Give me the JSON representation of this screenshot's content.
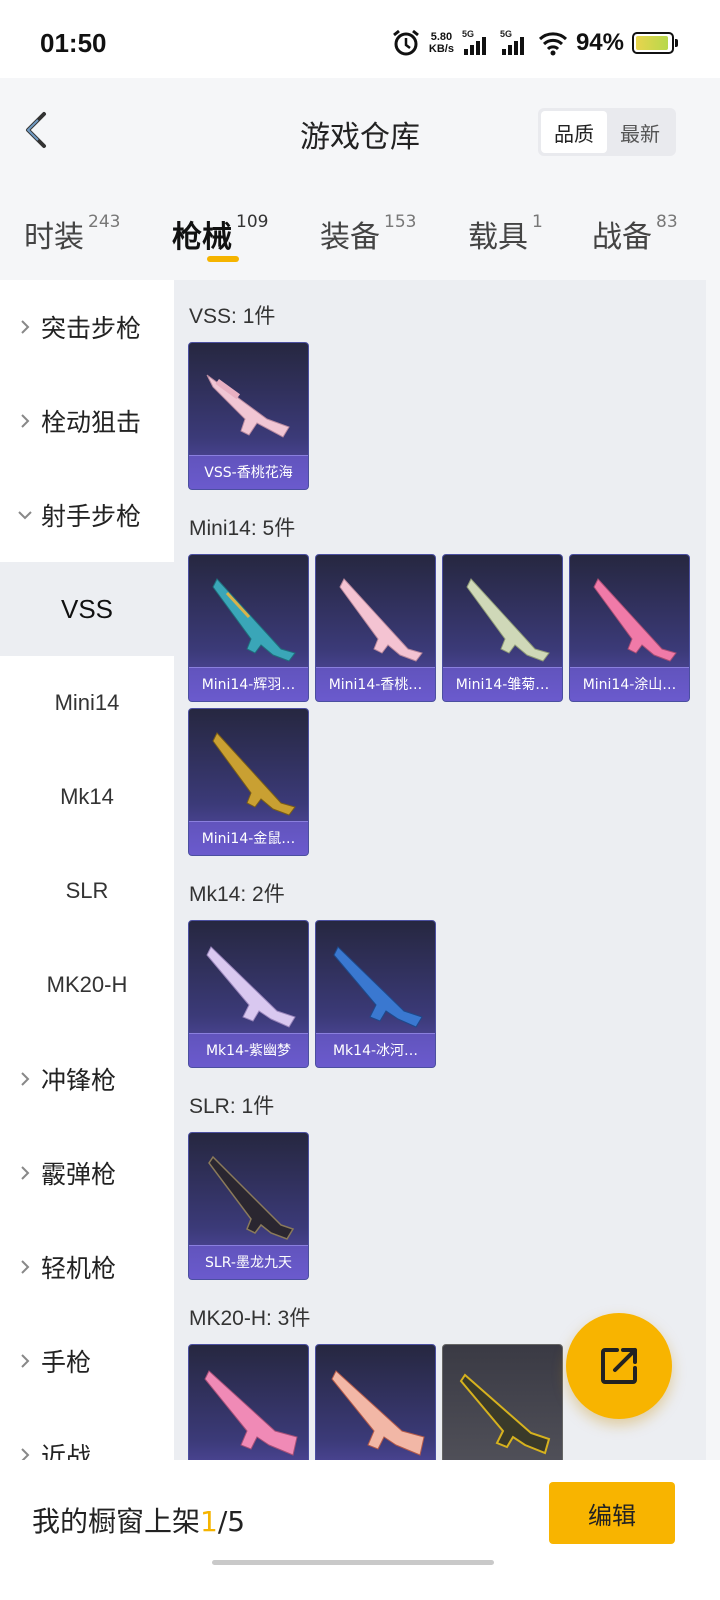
{
  "status_bar": {
    "time": "01:50",
    "net_speed_value": "5.80",
    "net_speed_unit": "KB/s",
    "sim1_label": "5G",
    "sim2_label": "5G",
    "battery_percent": "94%",
    "battery_level": 0.94
  },
  "header": {
    "title": "游戏仓库",
    "sort_quality": "品质",
    "sort_latest": "最新"
  },
  "tabs": [
    {
      "name": "时装",
      "count": "243"
    },
    {
      "name": "枪械",
      "count": "109"
    },
    {
      "name": "装备",
      "count": "153"
    },
    {
      "name": "载具",
      "count": "1"
    },
    {
      "name": "战备",
      "count": "83"
    }
  ],
  "sidebar": {
    "categories": [
      "突击步枪",
      "栓动狙击",
      "射手步枪",
      "冲锋枪",
      "霰弹枪",
      "轻机枪",
      "手枪",
      "近战"
    ],
    "subitems": [
      "VSS",
      "Mini14",
      "Mk14",
      "SLR",
      "MK20-H"
    ]
  },
  "groups": [
    {
      "title": "VSS: 1件",
      "items": [
        "VSS-香桃花海"
      ]
    },
    {
      "title": "Mini14: 5件",
      "items": [
        "Mini14-辉羽…",
        "Mini14-香桃…",
        "Mini14-雏菊…",
        "Mini14-涂山…",
        "Mini14-金鼠…"
      ]
    },
    {
      "title": "Mk14: 2件",
      "items": [
        "Mk14-紫幽梦",
        "Mk14-冰河…"
      ]
    },
    {
      "title": "SLR: 1件",
      "items": [
        "SLR-墨龙九天"
      ]
    },
    {
      "title": "MK20-H: 3件",
      "items": []
    }
  ],
  "bottom": {
    "showcase_prefix": "我的橱窗上架",
    "showcase_current": "1",
    "showcase_total": "/5",
    "edit_label": "编辑"
  },
  "colors": {
    "accent": "#f8b400",
    "card_bg": "#3b3a78",
    "card_label": "#7864e6"
  },
  "icons": {
    "back": "back-chevron-icon",
    "share": "share-external-icon",
    "expand": "chevron-right-icon",
    "collapse": "chevron-down-icon"
  }
}
